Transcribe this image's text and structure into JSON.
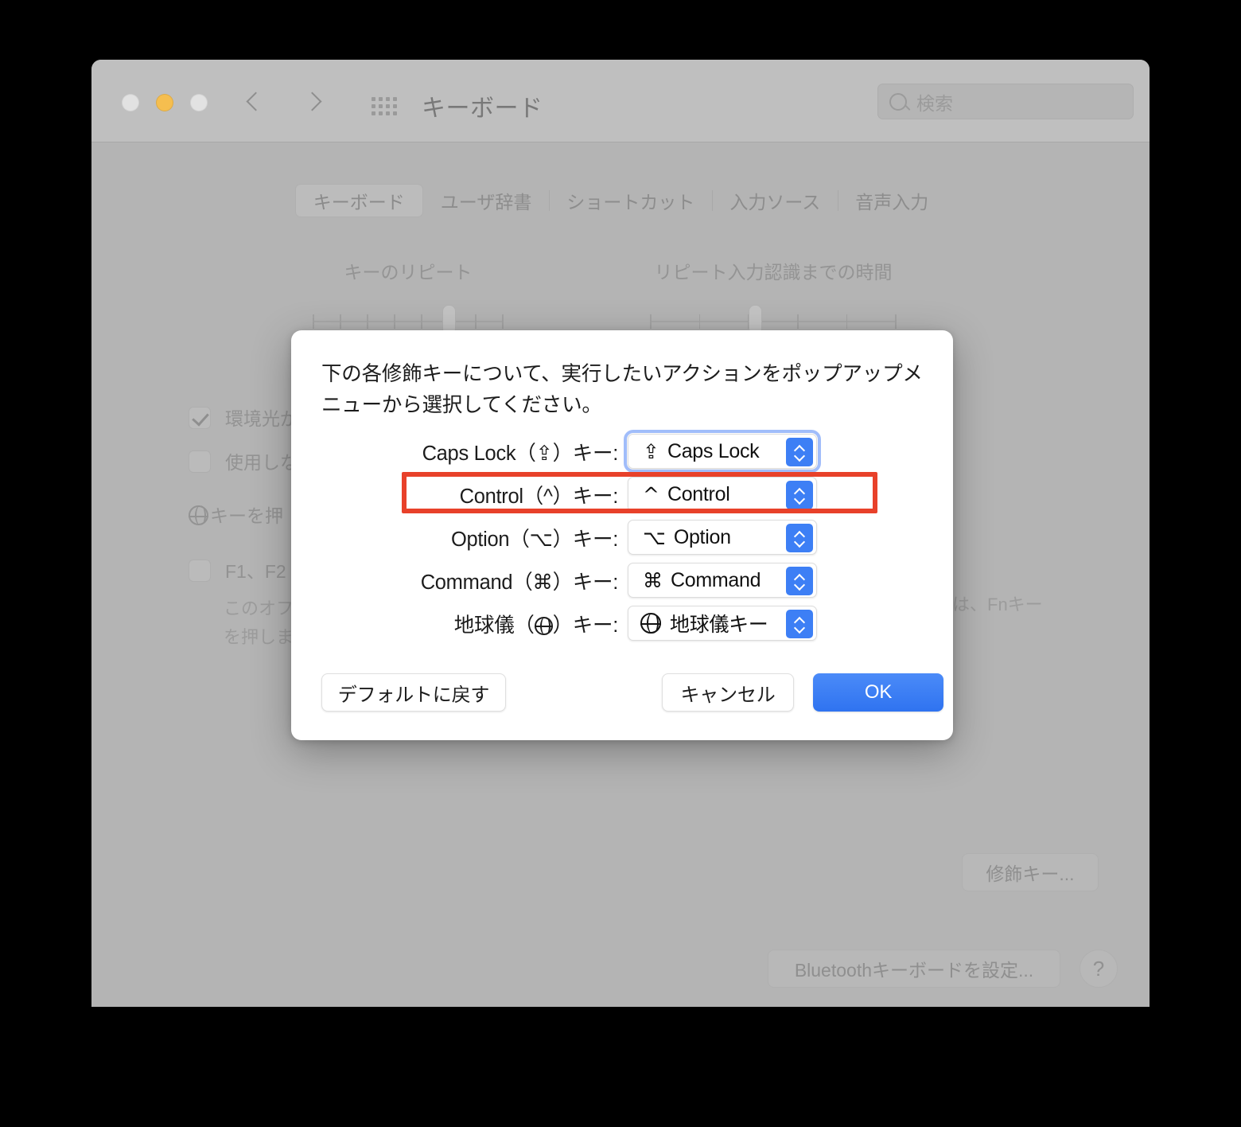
{
  "window": {
    "title": "キーボード",
    "traffic_lights": [
      "close",
      "minimize",
      "zoom"
    ],
    "amber_color": "#f5be4f",
    "search": {
      "placeholder": "検索",
      "value": ""
    },
    "nav": {
      "back": "back-arrow",
      "forward": "forward-arrow",
      "grid": "show-all-grid"
    }
  },
  "tabs": [
    {
      "label": "キーボード",
      "selected": true
    },
    {
      "label": "ユーザ辞書",
      "selected": false
    },
    {
      "label": "ショートカット",
      "selected": false
    },
    {
      "label": "入力ソース",
      "selected": false
    },
    {
      "label": "音声入力",
      "selected": false
    }
  ],
  "sliders": [
    {
      "label": "キーのリピート",
      "ticks": 8,
      "value_pct": 68
    },
    {
      "label": "リピート入力認識までの時間",
      "ticks": 6,
      "value_pct": 42
    }
  ],
  "checkboxes": [
    {
      "label": "環境光が",
      "checked": true
    },
    {
      "label": "使用しな",
      "checked": false
    },
    {
      "label": "F1、F2",
      "checked": false
    }
  ],
  "globe_row_label": "キーを押",
  "fn_description": {
    "line1": "このオフ",
    "line2": "を押しま",
    "right_fragment": "には、Fnキー"
  },
  "bottom_buttons": {
    "modifier_keys": "修飾キー...",
    "bluetooth_keyboard": "Bluetoothキーボードを設定...",
    "help": "?"
  },
  "dialog": {
    "instruction": "下の各修飾キーについて、実行したいアクションをポップアップメニューから選択してください。",
    "rows": [
      {
        "label": "Caps Lock（⇪）キー:",
        "symbol": "⇪",
        "value": "Caps Lock",
        "focused": true,
        "highlighted": false
      },
      {
        "label": "Control（^）キー:",
        "symbol": "^",
        "value": "Control",
        "focused": false,
        "highlighted": true
      },
      {
        "label": "Option（⌥）キー:",
        "symbol": "⌥",
        "value": "Option",
        "focused": false,
        "highlighted": false
      },
      {
        "label": "Command（⌘）キー:",
        "symbol": "⌘",
        "value": "Command",
        "focused": false,
        "highlighted": false
      },
      {
        "label": "地球儀（⊕）キー:",
        "symbol": "globe-icon",
        "value": "地球儀キー",
        "focused": false,
        "highlighted": false
      }
    ],
    "buttons": {
      "restore_defaults": "デフォルトに戻す",
      "cancel": "キャンセル",
      "ok": "OK"
    }
  },
  "annotation": {
    "color": "#e8412a",
    "target": "control-key-row"
  }
}
